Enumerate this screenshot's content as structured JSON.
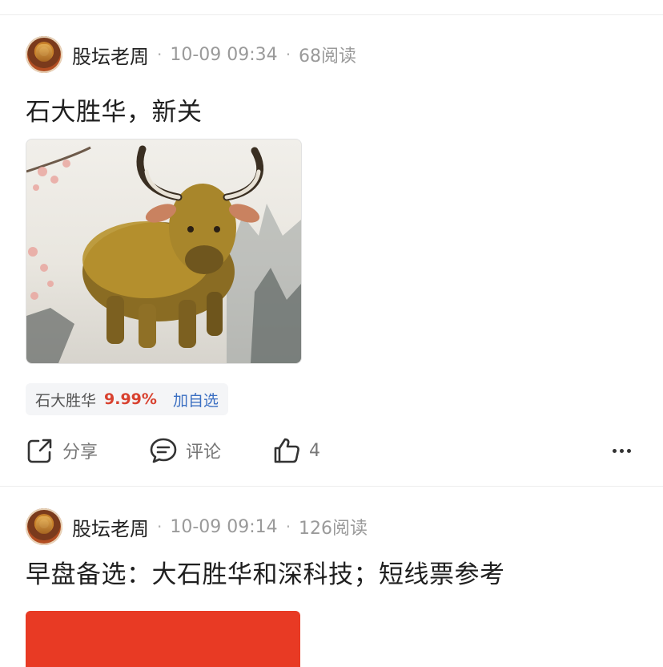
{
  "posts": [
    {
      "author": "股坛老周",
      "time": "10-09 09:34",
      "reads": "68阅读",
      "title": "石大胜华，新关",
      "stock": {
        "name": "石大胜华",
        "change": "9.99%",
        "add_label": "加自选"
      },
      "actions": {
        "share": "分享",
        "comment": "评论",
        "like_count": "4"
      }
    },
    {
      "author": "股坛老周",
      "time": "10-09 09:14",
      "reads": "126阅读",
      "title": "早盘备选：大石胜华和深科技；短线票参考"
    }
  ],
  "colors": {
    "stock_up": "#d8412f",
    "link_blue": "#3b6fc2",
    "image2_red": "#e83a24"
  },
  "icons": [
    "share-icon",
    "comment-icon",
    "like-icon",
    "more-icon"
  ]
}
